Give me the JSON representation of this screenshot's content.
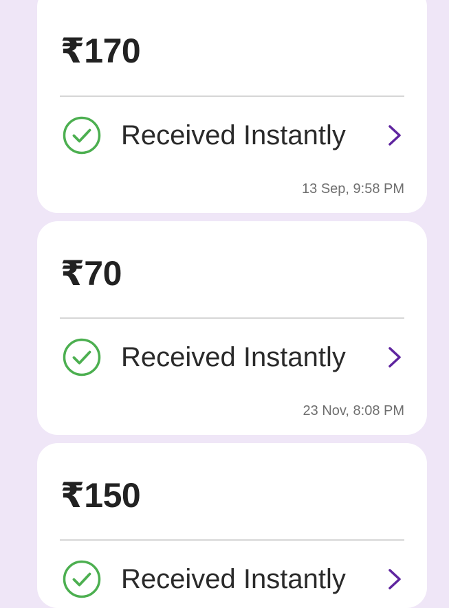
{
  "transactions": [
    {
      "amount": "₹170",
      "status": "Received Instantly",
      "status_icon": "check-circle-icon",
      "timestamp": "13 Sep, 9:58 PM"
    },
    {
      "amount": "₹70",
      "status": "Received Instantly",
      "status_icon": "check-circle-icon",
      "timestamp": "23 Nov, 8:08 PM"
    },
    {
      "amount": "₹150",
      "status": "Received Instantly",
      "status_icon": "check-circle-icon"
    }
  ],
  "colors": {
    "background": "#efe6f7",
    "card": "#ffffff",
    "success": "#4caf50",
    "accent": "#5f259f",
    "divider": "#d6d6d6"
  }
}
